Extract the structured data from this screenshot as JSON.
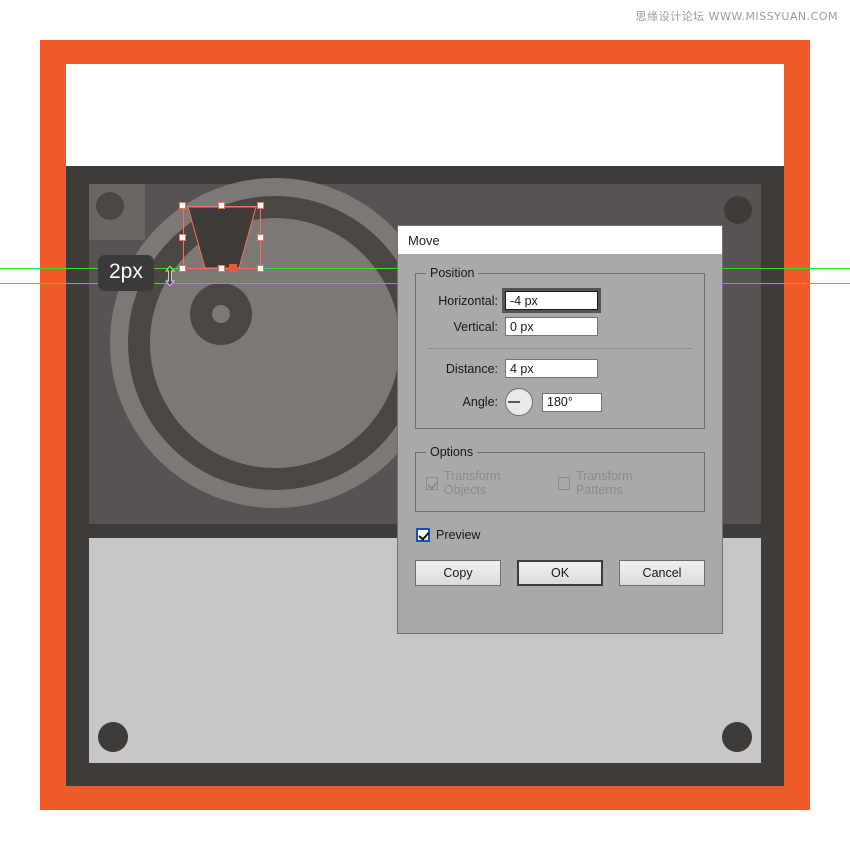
{
  "watermark": {
    "text": "思缘设计论坛  WWW.MISSYUAN.COM"
  },
  "canvas": {
    "measure_tooltip": "2px",
    "cursor_icon": "move-vertical-cursor",
    "guide_color": "#27e527",
    "selection_color": "#f4705a",
    "artboard_background": "#f05a28",
    "artwork_name": "turntable-illustration"
  },
  "dialog": {
    "title": "Move",
    "groups": {
      "position": {
        "legend": "Position",
        "fields": [
          {
            "label": "Horizontal:",
            "value": "-4 px",
            "focused": true
          },
          {
            "label": "Vertical:",
            "value": "0 px",
            "focused": false
          }
        ],
        "distance": {
          "label": "Distance:",
          "value": "4 px"
        },
        "angle": {
          "label": "Angle:",
          "value": "180°",
          "dial_icon": "angle-dial"
        }
      },
      "options": {
        "legend": "Options",
        "items": [
          {
            "label": "Transform Objects",
            "checked": true,
            "enabled": false
          },
          {
            "label": "Transform Patterns",
            "checked": false,
            "enabled": false
          }
        ]
      }
    },
    "preview": {
      "label": "Preview",
      "checked": true
    },
    "buttons": {
      "copy": "Copy",
      "ok": "OK",
      "cancel": "Cancel"
    }
  }
}
